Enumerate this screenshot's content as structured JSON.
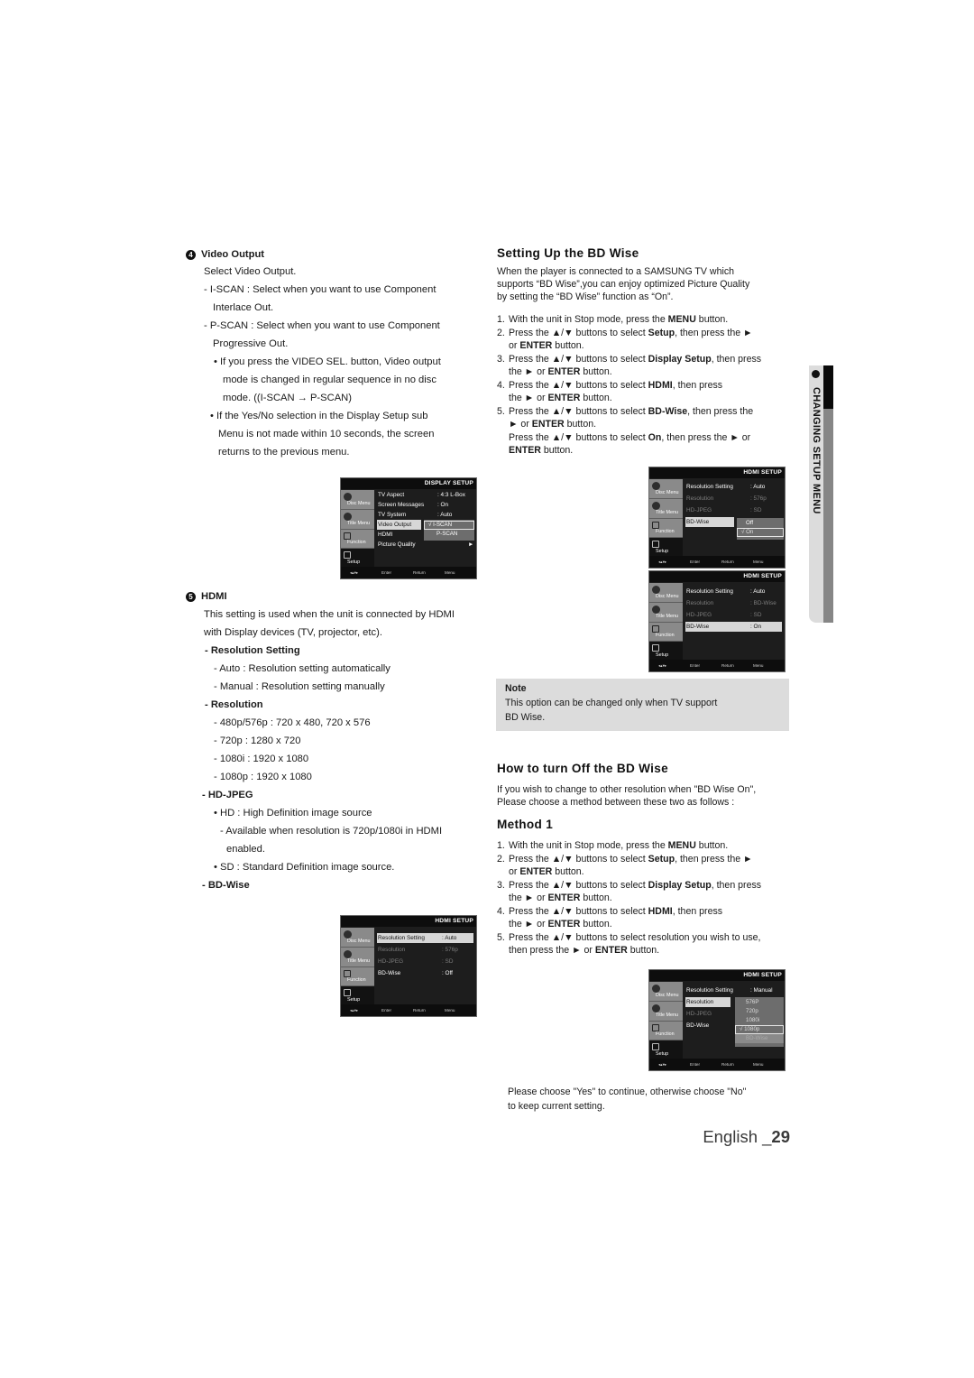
{
  "left": {
    "video_output": {
      "num": "4",
      "heading": "Video Output",
      "lines": [
        "Select Video Output.",
        "- I-SCAN : Select when you want to use Component",
        "Interlace Out.",
        "- P-SCAN : Select when you want to use Component",
        "Progressive Out.",
        "• If you press the VIDEO SEL. button, Video output",
        "mode is changed in regular sequence in no disc",
        "mode. ((I-SCAN → P-SCAN)",
        "• If the Yes/No selection in the Display Setup sub",
        "Menu is not made within 10 seconds, the screen",
        "returns to the previous menu."
      ]
    },
    "hdmi": {
      "num": "5",
      "heading": "HDMI",
      "intro": [
        "This setting is used when the unit is connected by HDMI",
        "with Display devices (TV, projector, etc)."
      ],
      "res_setting_heading": "- Resolution Setting",
      "res_setting_items": [
        "- Auto : Resolution setting automatically",
        "- Manual : Resolution setting manually"
      ],
      "resolution_heading": "- Resolution",
      "resolution_items": [
        "- 480p/576p :  720 x 480, 720 x 576",
        "- 720p : 1280 x 720",
        "- 1080i : 1920 x 1080",
        "- 1080p : 1920 x 1080"
      ],
      "hdjpeg_heading": "- HD-JPEG",
      "hdjpeg_items": [
        "• HD : High Definition image source",
        "- Available when resolution is 720p/1080i in HDMI",
        "enabled.",
        "• SD : Standard Definition image source."
      ],
      "bdwise_heading": "- BD-Wise"
    }
  },
  "osd_common": {
    "side": [
      "Disc Menu",
      "Title Menu",
      "Function",
      "Setup"
    ],
    "footer": [
      "◂▴▾▸",
      "Enter",
      "Return",
      "Menu"
    ]
  },
  "osd_display": {
    "title": "DISPLAY SETUP",
    "rows": [
      {
        "k": "TV Aspect",
        "v": ": 4:3 L-Box"
      },
      {
        "k": "Screen Messages",
        "v": ": On"
      },
      {
        "k": "TV System",
        "v": ": Auto"
      },
      {
        "k": "Video Output",
        "v": ""
      },
      {
        "k": "HDMI",
        "v": ""
      },
      {
        "k": "Picture Quality",
        "v": "►"
      }
    ],
    "popup": [
      "√ I-SCAN",
      "P-SCAN"
    ]
  },
  "osd_hdmi_left": {
    "title": "HDMI SETUP",
    "rows": [
      {
        "k": "Resolution Setting",
        "v": ": Auto"
      },
      {
        "k": "Resolution",
        "v": ": 576p"
      },
      {
        "k": "HD-JPEG",
        "v": ": SD"
      },
      {
        "k": "BD-Wise",
        "v": ": Off"
      }
    ]
  },
  "right": {
    "setup_title": "Setting Up the BD Wise",
    "setup_intro": [
      "When the player is connected to a SAMSUNG TV which",
      "supports “BD Wise”,you can enjoy optimized Picture Quality",
      "by setting the “BD Wise” function as “On”."
    ],
    "setup_steps": [
      {
        "n": "1.",
        "lines": [
          "With the unit in Stop mode, press the <b>MENU</b> button."
        ]
      },
      {
        "n": "2.",
        "lines": [
          "Press the ▲/▼ buttons to select <b>Setup</b>, then press the ►",
          "or <b>ENTER</b> button."
        ]
      },
      {
        "n": "3.",
        "lines": [
          "Press the ▲/▼ buttons to select <b>Display Setup</b>, then press",
          "the ► or <b>ENTER</b> button."
        ]
      },
      {
        "n": "4.",
        "lines": [
          "Press the ▲/▼ buttons to select <b>HDMI</b>, then press",
          "the ► or <b>ENTER</b> button."
        ]
      },
      {
        "n": "5.",
        "lines": [
          "Press the ▲/▼ buttons to select <b>BD-Wise</b>, then press the",
          "► or <b>ENTER</b> button.",
          "Press the ▲/▼ buttons to select <b>On</b>, then press the ► or",
          "<b>ENTER</b> button."
        ]
      }
    ],
    "note_label": "Note",
    "note_text": [
      "This option can be changed only when TV support",
      "BD Wise."
    ],
    "off_title": "How to turn Off the BD Wise",
    "off_intro": [
      "If you wish to change to other resolution when \"BD Wise On\",",
      "Please choose a method between these two as follows :"
    ],
    "method_title": "Method 1",
    "method_steps": [
      {
        "n": "1.",
        "lines": [
          "With the unit in Stop mode, press the <b>MENU</b> button."
        ]
      },
      {
        "n": "2.",
        "lines": [
          "Press the ▲/▼ buttons to select <b>Setup</b>, then press the ►",
          "or <b>ENTER</b> button."
        ]
      },
      {
        "n": "3.",
        "lines": [
          "Press the ▲/▼ buttons to select <b>Display Setup</b>, then press",
          "the ► or <b>ENTER</b> button."
        ]
      },
      {
        "n": "4.",
        "lines": [
          "Press the ▲/▼ buttons to select <b>HDMI</b>, then press",
          "the ► or <b>ENTER</b> button."
        ]
      },
      {
        "n": "5.",
        "lines": [
          "Press the ▲/▼ buttons to select resolution you wish to use,",
          "then press the ► or <b>ENTER</b> button."
        ]
      }
    ],
    "closing": [
      "Please choose \"Yes\" to continue, otherwise choose \"No\"",
      "to keep current setting."
    ]
  },
  "osd_hdmi_r1": {
    "title": "HDMI SETUP",
    "rows": [
      {
        "k": "Resolution Setting",
        "v": ": Auto"
      },
      {
        "k": "Resolution",
        "v": ": 576p"
      },
      {
        "k": "HD-JPEG",
        "v": ": SD"
      },
      {
        "k": "BD-Wise",
        "v": ""
      }
    ],
    "popup": [
      "Off",
      "√ On"
    ]
  },
  "osd_hdmi_r2": {
    "title": "HDMI SETUP",
    "rows": [
      {
        "k": "Resolution Setting",
        "v": ": Auto"
      },
      {
        "k": "Resolution",
        "v": ": BD-Wise"
      },
      {
        "k": "HD-JPEG",
        "v": ": SD"
      },
      {
        "k": "BD-Wise",
        "v": ": On"
      }
    ]
  },
  "osd_hdmi_r3": {
    "title": "HDMI SETUP",
    "rows": [
      {
        "k": "Resolution Setting",
        "v": ": Manual"
      },
      {
        "k": "Resolution",
        "v": ""
      },
      {
        "k": "HD-JPEG",
        "v": ""
      },
      {
        "k": "BD-Wise",
        "v": ""
      }
    ],
    "popup": [
      "576P",
      "720p",
      "1080i",
      "√ 1080p",
      "BD-Wise"
    ]
  },
  "side_tab": {
    "label": "CHANGING SETUP MENU"
  },
  "footer": {
    "lang": "English _",
    "page": "29"
  }
}
